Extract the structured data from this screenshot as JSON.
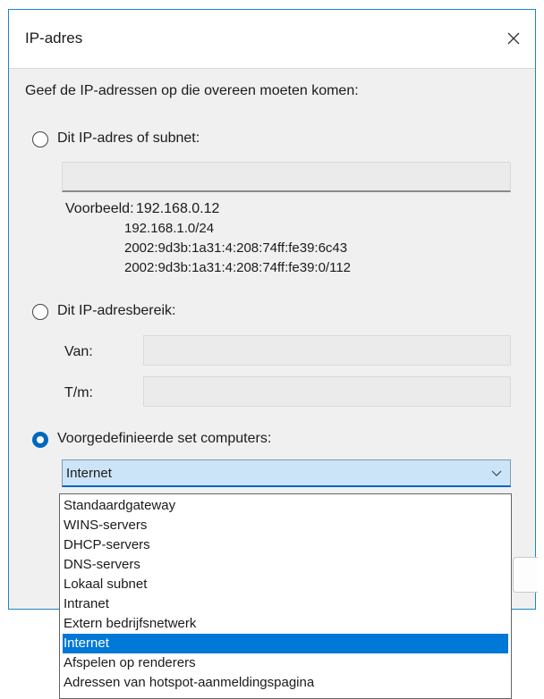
{
  "dialog": {
    "title": "IP-adres",
    "instruction": "Geef de IP-adressen op die overeen moeten komen:",
    "option_single": "Dit IP-adres of subnet:",
    "example_label": "Voorbeeld:",
    "examples": [
      "192.168.0.12",
      "192.168.1.0/24",
      "2002:9d3b:1a31:4:208:74ff:fe39:6c43",
      "2002:9d3b:1a31:4:208:74ff:fe39:0/112"
    ],
    "option_range": "Dit IP-adresbereik:",
    "from_label": "Van:",
    "to_label": "T/m:",
    "option_predefined": "Voorgedefinieerde set computers:",
    "selected_value": "Internet",
    "selected_option": "predefined"
  },
  "dropdown": {
    "options": [
      "Standaardgateway",
      "WINS-servers",
      "DHCP-servers",
      "DNS-servers",
      "Lokaal subnet",
      "Intranet",
      "Extern bedrijfsnetwerk",
      "Internet",
      "Afspelen op renderers",
      "Adressen van hotspot-aanmeldingspagina"
    ],
    "highlighted_index": 7
  },
  "colors": {
    "accent": "#0067c0",
    "highlight": "#0078d7",
    "border": "#1f84c7"
  },
  "icons": {
    "close": "close-icon",
    "chevron": "chevron-down-icon"
  }
}
